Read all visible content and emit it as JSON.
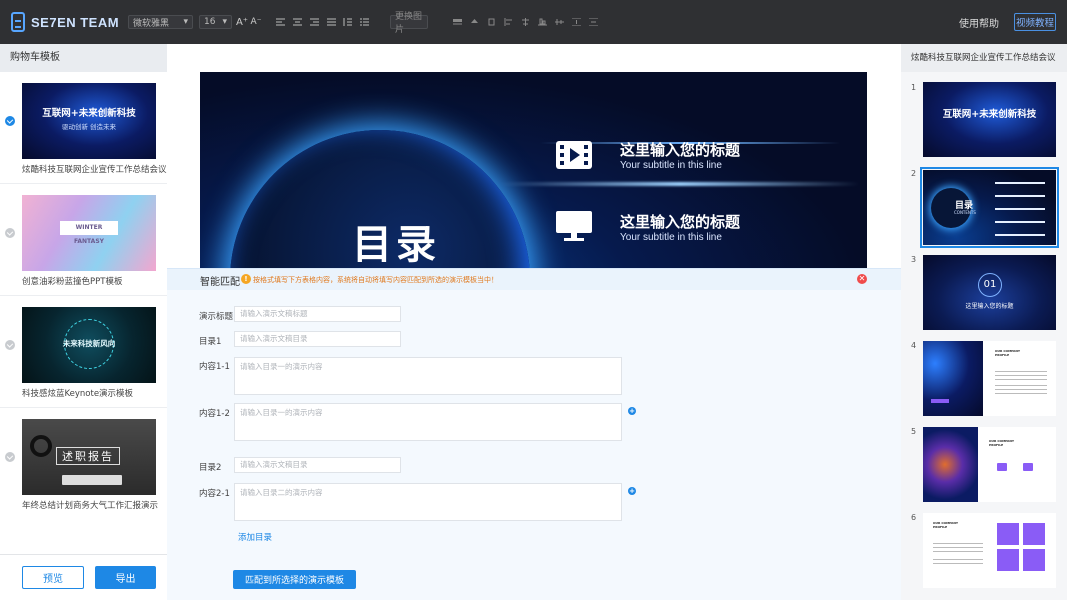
{
  "topbar": {
    "logo_text": "SE7EN TEAM",
    "font_family": "微软雅黑",
    "font_size": "16",
    "font_grow": "A⁺",
    "font_shrink": "A⁻",
    "replace_image": "更换图片",
    "help": "使用帮助",
    "video_tutorial": "视频教程"
  },
  "left_panel": {
    "title": "购物车模板",
    "templates": [
      {
        "name": "炫酷科技互联网企业宣传工作总结会议",
        "selected": true,
        "thumb_title": "互联网+未来创新科技",
        "thumb_sub": "驱动创新    创造未来"
      },
      {
        "name": "创意油彩粉蓝撞色PPT模板",
        "selected": false,
        "thumb_title": "WINTER FANTASY"
      },
      {
        "name": "科技感炫蓝Keynote演示模板",
        "selected": false,
        "thumb_title": "未来科技新风向"
      },
      {
        "name": "年终总结计划商务大气工作汇报演示",
        "selected": false,
        "thumb_title": "述职报告"
      }
    ],
    "preview": "预览",
    "export": "导出"
  },
  "slide": {
    "heading": "目录",
    "items": [
      {
        "title": "这里输入您的标题",
        "subtitle": "Your subtitle in this line",
        "icon": "video-icon"
      },
      {
        "title": "这里输入您的标题",
        "subtitle": "Your subtitle in this line",
        "icon": "monitor-icon"
      }
    ]
  },
  "smart": {
    "label": "智能匹配",
    "tip": "按格式填写下方表格内容，系统将自动将填写内容匹配到所选的演示模板当中！"
  },
  "form": {
    "fields": [
      {
        "label": "演示标题",
        "placeholder": "请输入演示文稿标题"
      },
      {
        "label": "目录1",
        "placeholder": "请输入演示文稿目录"
      },
      {
        "label": "内容1-1",
        "placeholder": "请输入目录一的演示内容"
      },
      {
        "label": "内容1-2",
        "placeholder": "请输入目录一的演示内容"
      },
      {
        "label": "目录2",
        "placeholder": "请输入演示文稿目录"
      },
      {
        "label": "内容2-1",
        "placeholder": "请输入目录二的演示内容"
      }
    ],
    "add_dir": "添加目录",
    "match_button": "匹配到所选择的演示模板"
  },
  "right_panel": {
    "title": "炫酷科技互联网企业宣传工作总结会议",
    "slides": [
      {
        "num": "1",
        "title": "互联网+未来创新科技"
      },
      {
        "num": "2",
        "title": "目录",
        "sub": "CONTENTS"
      },
      {
        "num": "3",
        "title": "01",
        "sub": "这里输入您的标题"
      },
      {
        "num": "4",
        "title": "OUR COMPANY PROFILE"
      },
      {
        "num": "5",
        "title": "OUR COMPANY PROFILE"
      },
      {
        "num": "6",
        "title": "OUR COMPANY PROFILE"
      }
    ]
  },
  "colors": {
    "accent": "#1e88e5",
    "topbar": "#2f3033",
    "warning": "#f5a623",
    "close": "#f04b4b"
  }
}
